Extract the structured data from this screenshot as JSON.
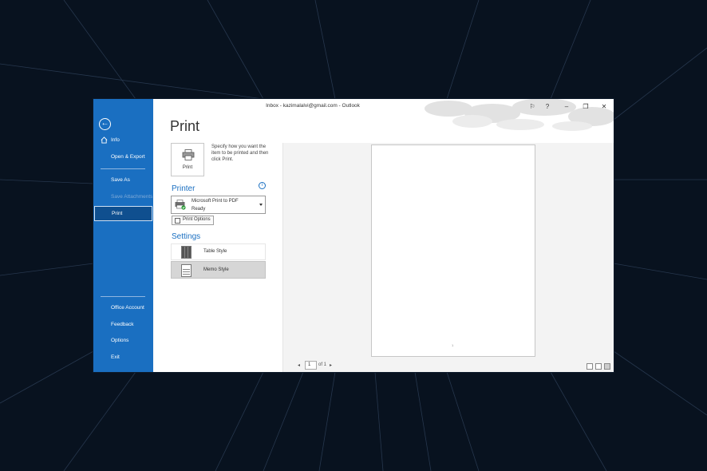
{
  "window": {
    "title": "Inbox - kazimalalvi@gmail.com  -  Outlook",
    "accent_color": "#1a6fc1"
  },
  "titlebar": {
    "buttons": [
      {
        "name": "coauthor-icon",
        "glyph": "⚐"
      },
      {
        "name": "help-icon",
        "glyph": "?"
      },
      {
        "name": "minimize-icon",
        "glyph": "–"
      },
      {
        "name": "restore-icon",
        "glyph": "❐"
      },
      {
        "name": "close-icon",
        "glyph": "✕"
      }
    ]
  },
  "sidebar": {
    "back_icon": "←",
    "items": [
      {
        "label": "Info",
        "icon": "home-icon"
      },
      {
        "label": "Open & Export"
      },
      {
        "label": "Save As"
      },
      {
        "label": "Save Attachments",
        "disabled": true
      },
      {
        "label": "Print",
        "active": true
      },
      {
        "label": "Office Account"
      },
      {
        "label": "Feedback"
      },
      {
        "label": "Options"
      },
      {
        "label": "Exit"
      }
    ]
  },
  "print": {
    "heading": "Print",
    "button_label": "Print",
    "description": "Specify how you want the item to be printed and then click Print.",
    "printer_section": "Printer",
    "info_glyph": "i",
    "printer_name": "Microsoft Print to PDF",
    "printer_status": "Ready",
    "print_options_label": "Print Options",
    "settings_section": "Settings",
    "styles": [
      {
        "label": "Table Style",
        "selected": false
      },
      {
        "label": "Memo Style",
        "selected": true
      }
    ]
  },
  "preview": {
    "page_number_mark": "1",
    "current_page": "1",
    "total_pages_label": "of 1",
    "prev_glyph": "◂",
    "next_glyph": "▸"
  }
}
